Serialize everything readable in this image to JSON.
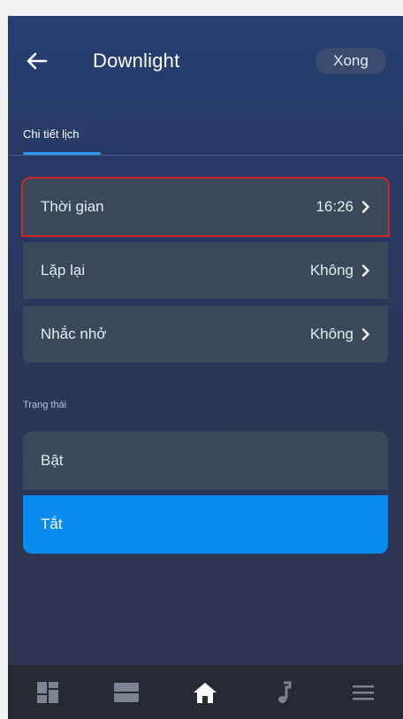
{
  "header": {
    "title": "Downlight",
    "done_label": "Xong"
  },
  "tabs": [
    {
      "label": "Chi tiết lịch",
      "active": true
    }
  ],
  "settings": [
    {
      "label": "Thời gian",
      "value": "16:26",
      "highlighted": true
    },
    {
      "label": "Lặp lại",
      "value": "Không"
    },
    {
      "label": "Nhắc nhở",
      "value": "Không"
    }
  ],
  "status": {
    "label": "Trạng thái",
    "options": [
      {
        "label": "Bật",
        "selected": false
      },
      {
        "label": "Tắt",
        "selected": true
      }
    ]
  },
  "bottom_nav": {
    "items": [
      {
        "icon": "dashboard-icon",
        "active": false
      },
      {
        "icon": "devices-icon",
        "active": false
      },
      {
        "icon": "home-icon",
        "active": true
      },
      {
        "icon": "music-icon",
        "active": false
      },
      {
        "icon": "menu-icon",
        "active": false
      }
    ]
  },
  "colors": {
    "accent": "#0a8bf0",
    "highlight_border": "#d0252b",
    "row_bg": "#3a4a5a"
  }
}
